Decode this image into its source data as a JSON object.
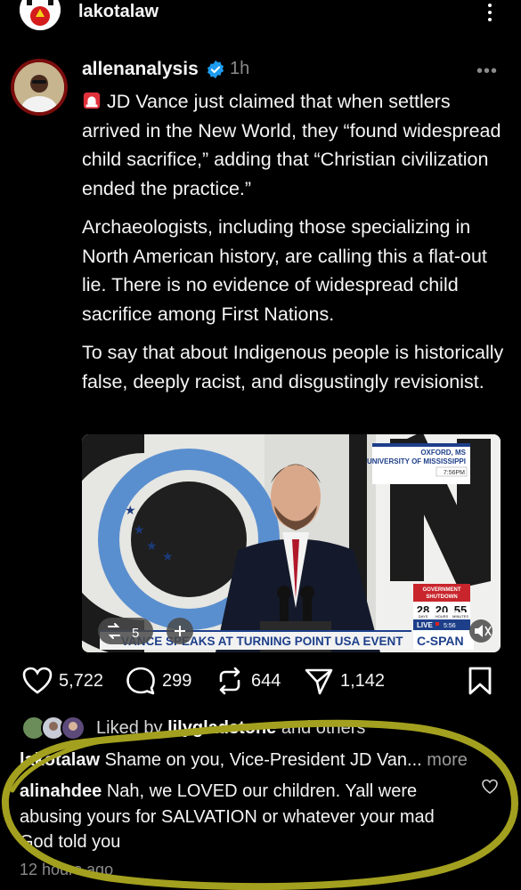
{
  "top": {
    "username": "lakotalaw"
  },
  "post": {
    "username": "allenanalysis",
    "time": "1h",
    "paragraphs": [
      "JD Vance just claimed that when settlers arrived in the New World, they “found widespread child sacrifice,” adding that “Christian civilization ended the practice.”",
      "Archaeologists, including those specializing in North American history, are calling this a flat-out lie. There is no evidence of widespread child sacrifice among First Nations.",
      "To say that about Indigenous people is historically false, deeply racist, and disgustingly revisionist."
    ]
  },
  "media": {
    "location_line1": "OXFORD, MS",
    "location_line2": "UNIVERSITY OF MISSISSIPPI",
    "time": "7:56PM",
    "gov_label_1": "GOVERNMENT",
    "gov_label_2": "SHUTDOWN",
    "days": "28",
    "hours": "20",
    "minutes": "55",
    "days_label": "DAYS",
    "hours_label": "HOURS",
    "minutes_label": "MINUTES",
    "live_label": "LIVE",
    "live_time": "5:56",
    "chyron": "VANCE SPEAKS AT TURNING POINT USA EVENT",
    "network": "C-SPAN",
    "repost_count": "5"
  },
  "actions": {
    "likes": "5,722",
    "comments": "299",
    "reposts": "644",
    "shares": "1,142"
  },
  "liked_by": {
    "prefix": "Liked by",
    "user": "lilygladstone",
    "suffix": "and others"
  },
  "comments": [
    {
      "user": "lakotalaw",
      "text": "Shame on you, Vice-President JD Van...",
      "more": "more"
    },
    {
      "user": "alinahdee",
      "text": "Nah, we LOVED our children.  Yall were abusing yours for SALVATION or whatever your mad God told you"
    }
  ],
  "time_ago": "12 hours ago"
}
